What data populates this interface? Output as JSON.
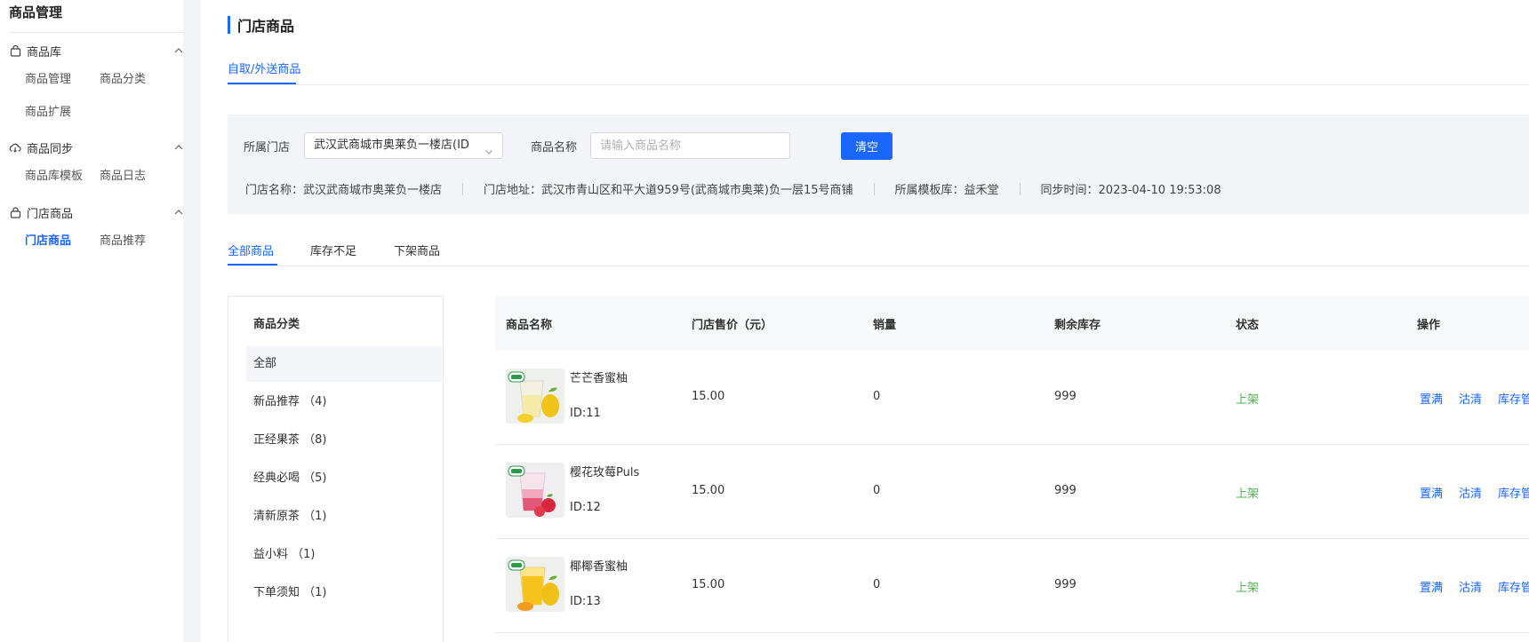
{
  "sidebar": {
    "title": "商品管理",
    "groups": [
      {
        "label": "商品库",
        "icon": "bag-icon",
        "items": [
          "商品管理",
          "商品分类",
          "商品扩展"
        ]
      },
      {
        "label": "商品同步",
        "icon": "cloud-sync-icon",
        "items": [
          "商品库模板",
          "商品日志"
        ]
      },
      {
        "label": "门店商品",
        "icon": "lock-bag-icon",
        "items": [
          "门店商品",
          "商品推荐"
        ]
      }
    ]
  },
  "page": {
    "title": "门店商品",
    "top_tab": "自取/外送商品"
  },
  "filter": {
    "store_label": "所属门店",
    "store_value": "武汉武商城市奥莱负一楼店(ID",
    "name_label": "商品名称",
    "name_placeholder": "请输入商品名称",
    "clear_button": "清空",
    "info": {
      "store_name": "门店名称：武汉武商城市奥莱负一楼店",
      "store_address": "门店地址：武汉市青山区和平大道959号(武商城市奥莱)负一层15号商铺",
      "template": "所属模板库：益禾堂",
      "sync_time": "同步时间：2023-04-10 19:53:08"
    }
  },
  "sub_tabs": [
    "全部商品",
    "库存不足",
    "下架商品"
  ],
  "categories": {
    "title": "商品分类",
    "items": [
      "全部",
      "新品推荐 （4)",
      "正经果茶 （8)",
      "经典必喝 （5)",
      "清新原茶 （1)",
      "益小料 （1)",
      "下单须知 （1)"
    ]
  },
  "table": {
    "headers": [
      "商品名称",
      "门店售价（元）",
      "销量",
      "剩余库存",
      "状态",
      "操作"
    ],
    "rows": [
      {
        "name": "芒芒香蜜柚",
        "id": "ID:11",
        "price": "15.00",
        "sales": "0",
        "stock": "999",
        "status": "上架",
        "ops": [
          "置满",
          "沽清",
          "库存管"
        ]
      },
      {
        "name": "樱花玫莓Puls",
        "id": "ID:12",
        "price": "15.00",
        "sales": "0",
        "stock": "999",
        "status": "上架",
        "ops": [
          "置满",
          "沽清",
          "库存管"
        ]
      },
      {
        "name": "椰椰香蜜柚",
        "id": "ID:13",
        "price": "15.00",
        "sales": "0",
        "stock": "999",
        "status": "上架",
        "ops": [
          "置满",
          "沽清",
          "库存管"
        ]
      }
    ]
  },
  "colors": {
    "primary": "#1a66ff",
    "status_on": "#52b352",
    "filter_bg": "#f2f4f7"
  }
}
